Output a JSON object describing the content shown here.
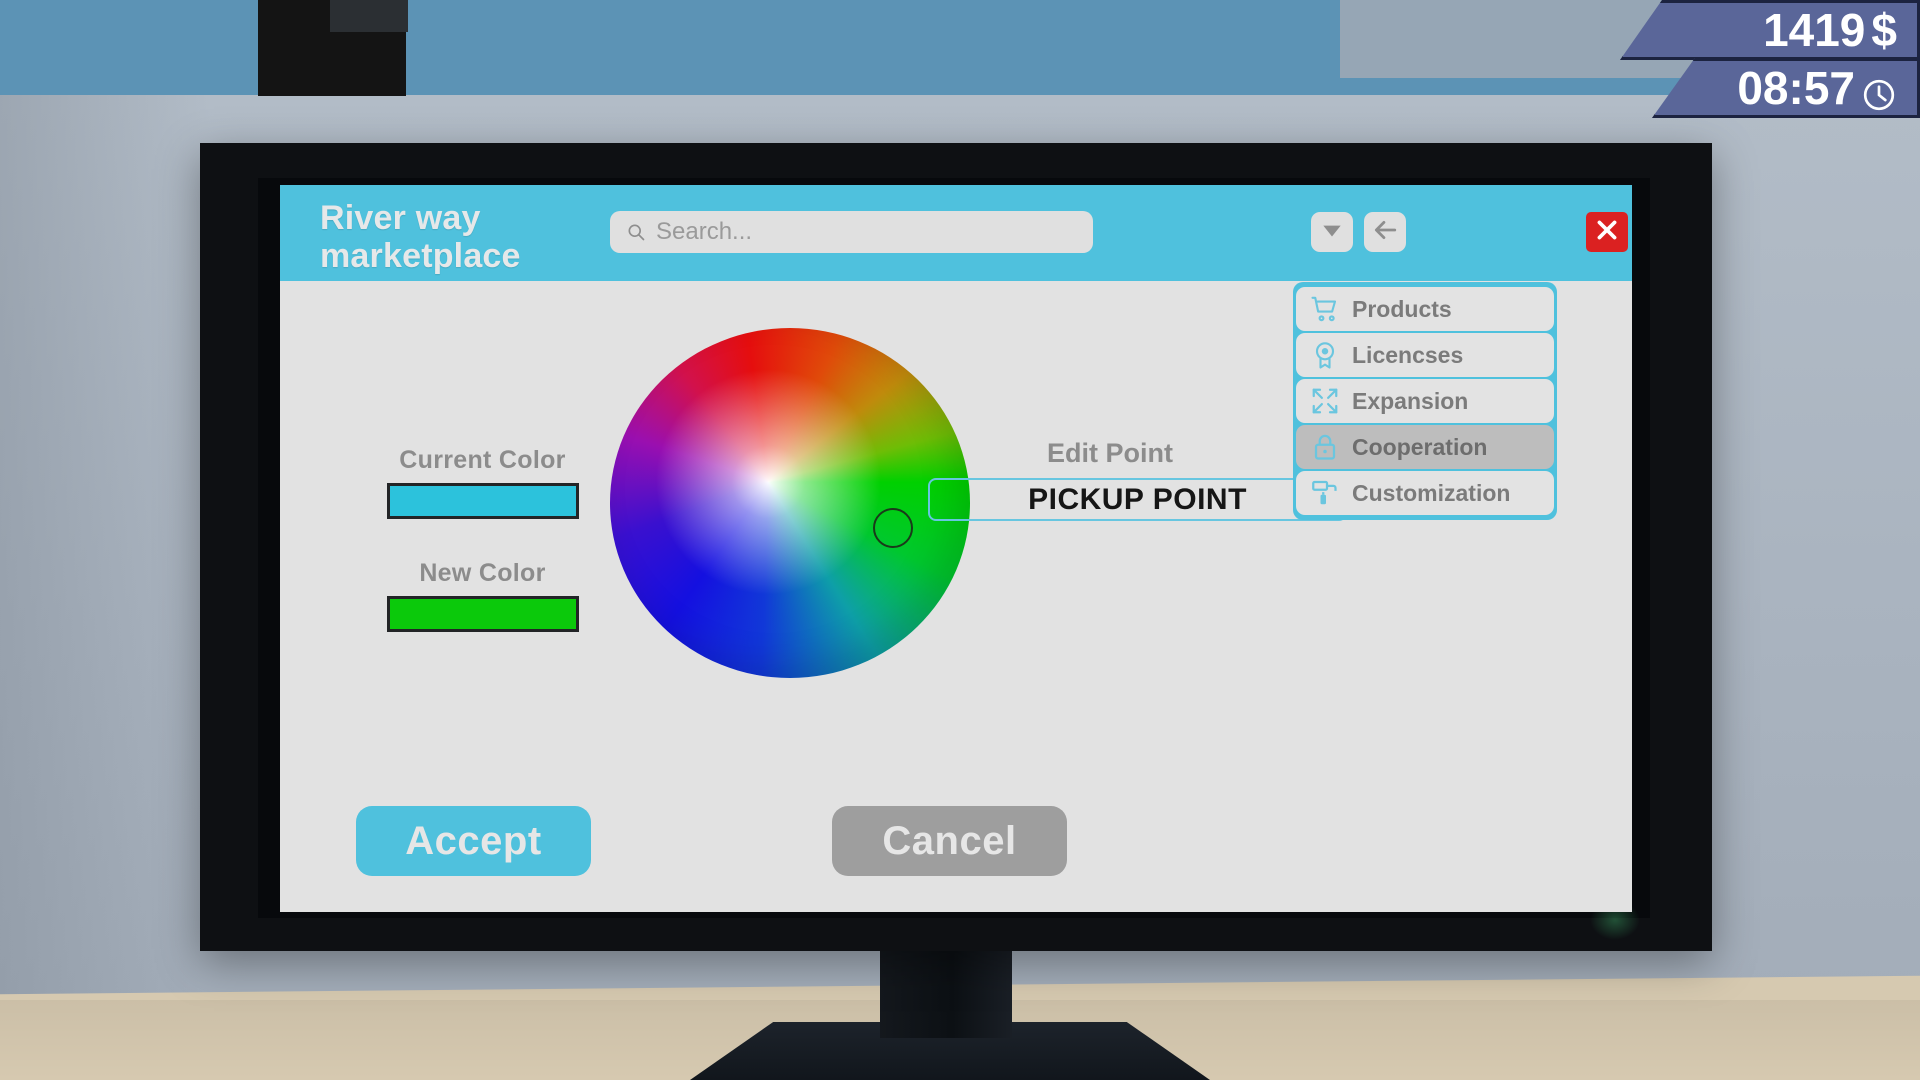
{
  "hud": {
    "money": "1419",
    "currency_symbol": "$",
    "time": "08:57",
    "clock_icon": "clock-icon"
  },
  "app": {
    "brand_line1": "River way",
    "brand_line2": "marketplace",
    "search": {
      "placeholder": "Search...",
      "value": "",
      "icon": "search-icon"
    },
    "header_buttons": [
      {
        "name": "dropdown-button",
        "icon": "chevron-down-icon"
      },
      {
        "name": "back-button",
        "icon": "arrow-left-icon"
      }
    ],
    "close_button": {
      "label": "close",
      "icon": "close-icon"
    }
  },
  "color_picker": {
    "current_color_label": "Current Color",
    "current_color_value": "#2CC2DC",
    "new_color_label": "New Color",
    "new_color_value": "#0BC90B",
    "wheel_name": "color-wheel",
    "cursor_name": "color-wheel-cursor"
  },
  "edit_point": {
    "label": "Edit Point",
    "value": "PICKUP POINT"
  },
  "sidebar": {
    "items": [
      {
        "label": "Products",
        "icon": "cart-icon",
        "active": false
      },
      {
        "label": "Licencses",
        "icon": "badge-icon",
        "active": false
      },
      {
        "label": "Expansion",
        "icon": "expand-arrows-icon",
        "active": false
      },
      {
        "label": "Cooperation",
        "icon": "lock-icon",
        "active": true
      },
      {
        "label": "Customization",
        "icon": "paint-roller-icon",
        "active": false
      }
    ]
  },
  "footer": {
    "accept_label": "Accept",
    "cancel_label": "Cancel"
  },
  "colors": {
    "accent": "#4FC1DD",
    "close_red": "#DB2121",
    "cancel_gray": "#9E9E9E",
    "hud_blue": "#5A6699",
    "screen_bg": "#E2E2E2"
  }
}
